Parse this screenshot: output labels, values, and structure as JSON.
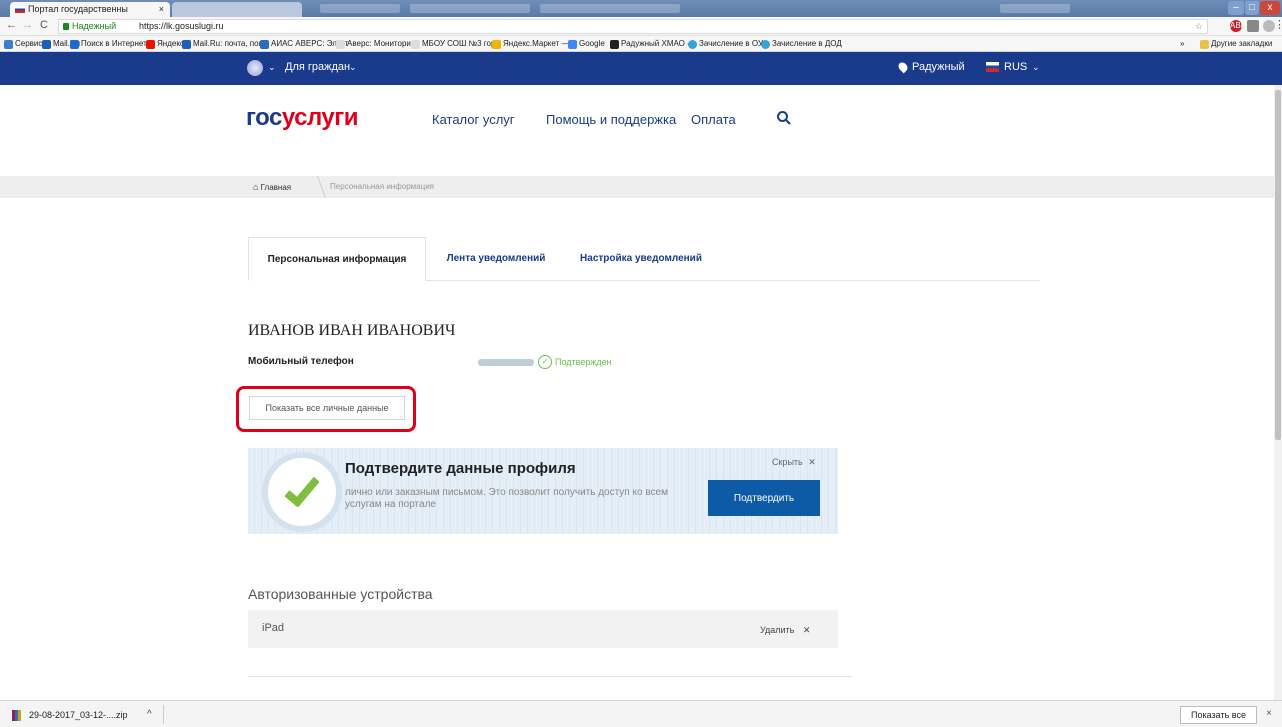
{
  "browser": {
    "tab_title": "Портал государственны",
    "tab_close": "×",
    "nav": {
      "back": "←",
      "forward": "→",
      "reload": "C"
    },
    "secure_label": "Надежный",
    "url": "https://lk.gosuslugi.ru",
    "bookmarks": [
      "Сервисы",
      "Mail.Ru",
      "Поиск в Интернете",
      "Яндекс",
      "Mail.Ru: почта, поис",
      "АИАС АВЕРС: Элект",
      "Аверс: Мониторинг",
      "МБОУ СОШ №3 гор",
      "Яндекс.Маркет — п",
      "Google",
      "Радужный ХМАО - ",
      "Зачисление в ОУ",
      "Зачисление в ДОД"
    ],
    "bookmarks_more": "»",
    "other_bookmarks": "Другие закладки"
  },
  "site_header": {
    "audience": "Для граждан",
    "location": "Радужный",
    "language": "RUS",
    "chevron": "⌄"
  },
  "logo": {
    "part1": "гос",
    "part2": "услуги"
  },
  "main_nav": [
    "Каталог услуг",
    "Помощь и поддержка",
    "Оплата"
  ],
  "breadcrumb": {
    "home": "Главная",
    "current": "Персональная информация"
  },
  "tabs": [
    "Персональная информация",
    "Лента уведомлений",
    "Настройка уведомлений"
  ],
  "profile": {
    "full_name": "ИВАНОВ ИВАН ИВАНОВИЧ",
    "phone_label": "Мобильный телефон",
    "phone_status": "Подтвержден",
    "show_all_button": "Показать все личные данные"
  },
  "confirm_banner": {
    "title": "Подтвердите данные профиля",
    "description": "лично или заказным письмом. Это позволит получить доступ ко всем услугам на портале",
    "hide_label": "Скрыть",
    "confirm_button": "Подтвердить"
  },
  "devices": {
    "title": "Авторизованные устройства",
    "items": [
      {
        "name": "iPad",
        "remove_label": "Удалить"
      }
    ]
  },
  "download_bar": {
    "file_name": "29-08-2017_03-12-....zip",
    "caret": "^",
    "show_all": "Показать все",
    "close": "×"
  },
  "colors": {
    "brand_blue": "#1a3a8c",
    "brand_red": "#e0001b",
    "confirm_green": "#6bbf4a",
    "button_blue": "#0d5aa7",
    "highlight_red": "#e0001b"
  }
}
